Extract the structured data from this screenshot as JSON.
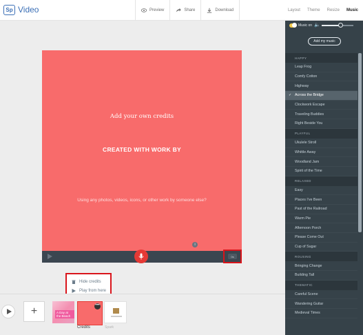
{
  "app": {
    "logo_text": "Sp",
    "title": "Video"
  },
  "toolbar": {
    "preview_label": "Preview",
    "share_label": "Share",
    "download_label": "Download"
  },
  "tabs": [
    {
      "label": "Layout",
      "active": false
    },
    {
      "label": "Theme",
      "active": false
    },
    {
      "label": "Resize",
      "active": false
    },
    {
      "label": "Music",
      "active": true
    }
  ],
  "slide": {
    "title": "Add your own credits",
    "subtitle": "CREATED WITH WORK BY",
    "question": "Using any photos, videos, icons, or other work by someone else?",
    "background_color": "#f86b6b"
  },
  "player": {
    "duration_label": "0s",
    "info_glyph": "i"
  },
  "context_menu": {
    "hide_label": "Hide credits",
    "play_label": "Play from here"
  },
  "filmstrip": {
    "add_label": "+",
    "thumb1_text": "A Day at the Beach",
    "thumb2_more": "•••",
    "credits_label": "Credits",
    "outro_label": "Spark"
  },
  "music": {
    "toggle_label": "Music on",
    "toggle_on": true,
    "volume_level": 0.6,
    "add_button": "Add my music",
    "categories": [
      {
        "name": "HAPPY",
        "songs": [
          "Leap Frog",
          "Comfy Cotton",
          "Highway",
          "Across the Bridge",
          "Clockwork Escape",
          "Traveling Buddies",
          "Right Beside You"
        ]
      },
      {
        "name": "PLAYFUL",
        "songs": [
          "Ukulele Stroll",
          "Whittle Away",
          "Woodland Jam",
          "Spirit of the Time"
        ]
      },
      {
        "name": "RELAXED",
        "songs": [
          "Easy",
          "Places I've Been",
          "Past of the Railroad",
          "Warm Pie",
          "Afternoon Porch",
          "Please Come Out",
          "Cup of Sugar"
        ]
      },
      {
        "name": "ROUSING",
        "songs": [
          "Bringing Change",
          "Building Tall"
        ]
      },
      {
        "name": "THEMATIC",
        "songs": [
          "Careful Scene",
          "Wandering Guitar",
          "Medieval Times"
        ]
      }
    ],
    "selected_song": "Across the Bridge"
  },
  "colors": {
    "accent": "#3b6fb6",
    "record": "#e53935",
    "highlight": "#d9141b",
    "sidebar": "#364249"
  }
}
